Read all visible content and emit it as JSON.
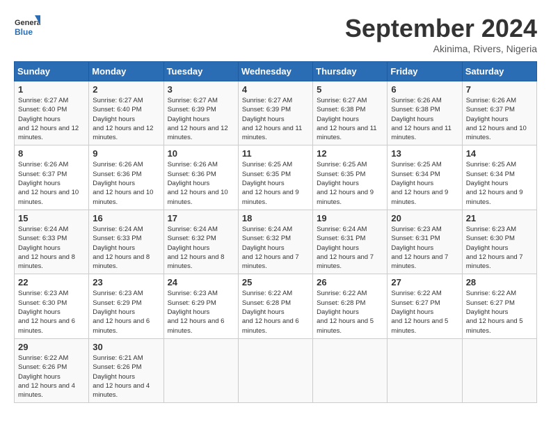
{
  "header": {
    "logo_line1": "General",
    "logo_line2": "Blue",
    "month": "September 2024",
    "location": "Akinima, Rivers, Nigeria"
  },
  "weekdays": [
    "Sunday",
    "Monday",
    "Tuesday",
    "Wednesday",
    "Thursday",
    "Friday",
    "Saturday"
  ],
  "weeks": [
    [
      {
        "day": "1",
        "sunrise": "6:27 AM",
        "sunset": "6:40 PM",
        "daylight": "12 hours and 12 minutes."
      },
      {
        "day": "2",
        "sunrise": "6:27 AM",
        "sunset": "6:40 PM",
        "daylight": "12 hours and 12 minutes."
      },
      {
        "day": "3",
        "sunrise": "6:27 AM",
        "sunset": "6:39 PM",
        "daylight": "12 hours and 12 minutes."
      },
      {
        "day": "4",
        "sunrise": "6:27 AM",
        "sunset": "6:39 PM",
        "daylight": "12 hours and 11 minutes."
      },
      {
        "day": "5",
        "sunrise": "6:27 AM",
        "sunset": "6:38 PM",
        "daylight": "12 hours and 11 minutes."
      },
      {
        "day": "6",
        "sunrise": "6:26 AM",
        "sunset": "6:38 PM",
        "daylight": "12 hours and 11 minutes."
      },
      {
        "day": "7",
        "sunrise": "6:26 AM",
        "sunset": "6:37 PM",
        "daylight": "12 hours and 10 minutes."
      }
    ],
    [
      {
        "day": "8",
        "sunrise": "6:26 AM",
        "sunset": "6:37 PM",
        "daylight": "12 hours and 10 minutes."
      },
      {
        "day": "9",
        "sunrise": "6:26 AM",
        "sunset": "6:36 PM",
        "daylight": "12 hours and 10 minutes."
      },
      {
        "day": "10",
        "sunrise": "6:26 AM",
        "sunset": "6:36 PM",
        "daylight": "12 hours and 10 minutes."
      },
      {
        "day": "11",
        "sunrise": "6:25 AM",
        "sunset": "6:35 PM",
        "daylight": "12 hours and 9 minutes."
      },
      {
        "day": "12",
        "sunrise": "6:25 AM",
        "sunset": "6:35 PM",
        "daylight": "12 hours and 9 minutes."
      },
      {
        "day": "13",
        "sunrise": "6:25 AM",
        "sunset": "6:34 PM",
        "daylight": "12 hours and 9 minutes."
      },
      {
        "day": "14",
        "sunrise": "6:25 AM",
        "sunset": "6:34 PM",
        "daylight": "12 hours and 9 minutes."
      }
    ],
    [
      {
        "day": "15",
        "sunrise": "6:24 AM",
        "sunset": "6:33 PM",
        "daylight": "12 hours and 8 minutes."
      },
      {
        "day": "16",
        "sunrise": "6:24 AM",
        "sunset": "6:33 PM",
        "daylight": "12 hours and 8 minutes."
      },
      {
        "day": "17",
        "sunrise": "6:24 AM",
        "sunset": "6:32 PM",
        "daylight": "12 hours and 8 minutes."
      },
      {
        "day": "18",
        "sunrise": "6:24 AM",
        "sunset": "6:32 PM",
        "daylight": "12 hours and 7 minutes."
      },
      {
        "day": "19",
        "sunrise": "6:24 AM",
        "sunset": "6:31 PM",
        "daylight": "12 hours and 7 minutes."
      },
      {
        "day": "20",
        "sunrise": "6:23 AM",
        "sunset": "6:31 PM",
        "daylight": "12 hours and 7 minutes."
      },
      {
        "day": "21",
        "sunrise": "6:23 AM",
        "sunset": "6:30 PM",
        "daylight": "12 hours and 7 minutes."
      }
    ],
    [
      {
        "day": "22",
        "sunrise": "6:23 AM",
        "sunset": "6:30 PM",
        "daylight": "12 hours and 6 minutes."
      },
      {
        "day": "23",
        "sunrise": "6:23 AM",
        "sunset": "6:29 PM",
        "daylight": "12 hours and 6 minutes."
      },
      {
        "day": "24",
        "sunrise": "6:23 AM",
        "sunset": "6:29 PM",
        "daylight": "12 hours and 6 minutes."
      },
      {
        "day": "25",
        "sunrise": "6:22 AM",
        "sunset": "6:28 PM",
        "daylight": "12 hours and 6 minutes."
      },
      {
        "day": "26",
        "sunrise": "6:22 AM",
        "sunset": "6:28 PM",
        "daylight": "12 hours and 5 minutes."
      },
      {
        "day": "27",
        "sunrise": "6:22 AM",
        "sunset": "6:27 PM",
        "daylight": "12 hours and 5 minutes."
      },
      {
        "day": "28",
        "sunrise": "6:22 AM",
        "sunset": "6:27 PM",
        "daylight": "12 hours and 5 minutes."
      }
    ],
    [
      {
        "day": "29",
        "sunrise": "6:22 AM",
        "sunset": "6:26 PM",
        "daylight": "12 hours and 4 minutes."
      },
      {
        "day": "30",
        "sunrise": "6:21 AM",
        "sunset": "6:26 PM",
        "daylight": "12 hours and 4 minutes."
      },
      null,
      null,
      null,
      null,
      null
    ]
  ]
}
